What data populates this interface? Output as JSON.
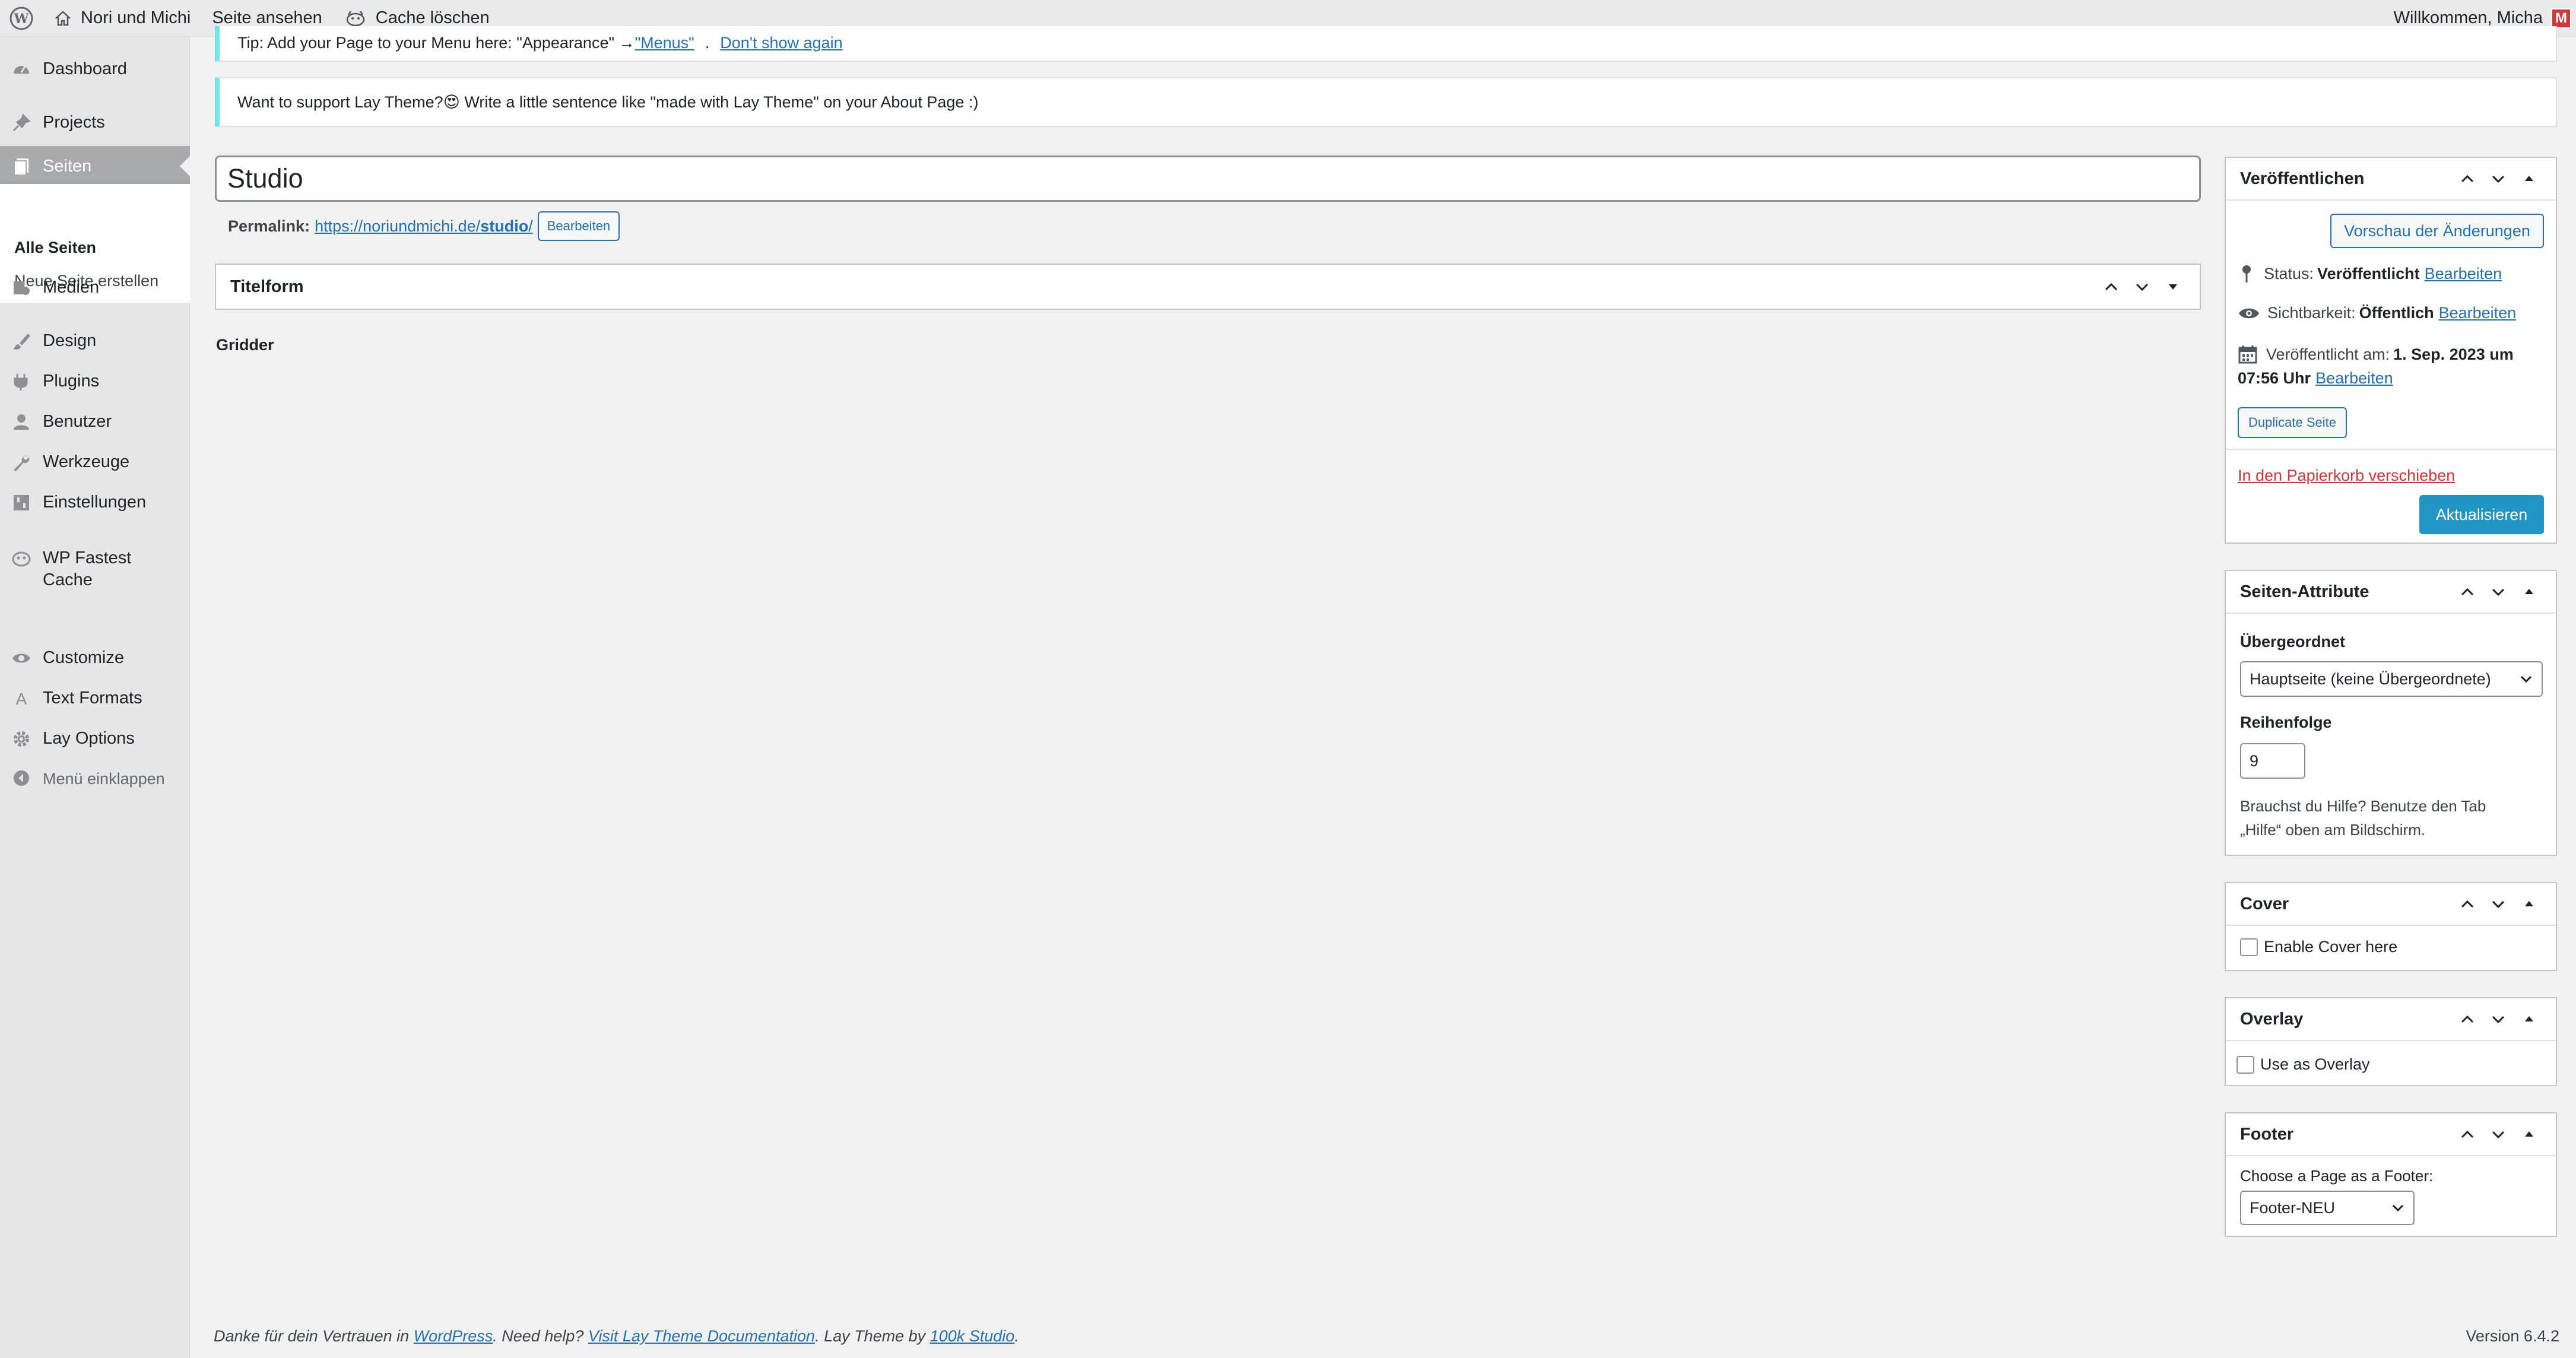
{
  "adminbar": {
    "site_name": "Nori und Michi",
    "view_site": "Seite ansehen",
    "clear_cache": "Cache löschen",
    "welcome": "Willkommen, Micha",
    "avatar_letter": "M"
  },
  "sidebar": {
    "items": [
      {
        "label": "Dashboard",
        "icon": "dashboard-icon"
      },
      {
        "label": "Projects",
        "icon": "pin-icon"
      },
      {
        "label": "Seiten",
        "icon": "pages-icon"
      },
      {
        "label": "Medien",
        "icon": "media-icon"
      },
      {
        "label": "Design",
        "icon": "brush-icon"
      },
      {
        "label": "Plugins",
        "icon": "plugin-icon"
      },
      {
        "label": "Benutzer",
        "icon": "user-icon"
      },
      {
        "label": "Werkzeuge",
        "icon": "wrench-icon"
      },
      {
        "label": "Einstellungen",
        "icon": "settings-icon"
      },
      {
        "label": "WP Fastest Cache",
        "icon": "cheetah-icon"
      },
      {
        "label": "Customize",
        "icon": "eye-icon"
      },
      {
        "label": "Text Formats",
        "icon": "text-icon"
      },
      {
        "label": "Lay Options",
        "icon": "gear-icon"
      }
    ],
    "submenu": [
      "Alle Seiten",
      "Neue Seite erstellen"
    ],
    "collapse": "Menü einklappen"
  },
  "notices": {
    "tip_prefix": "Tip: Add your Page to your Menu here: \"Appearance\" → ",
    "tip_link1": "\"Menus\"",
    "tip_link2": "Don't show again",
    "support": "Want to support Lay Theme?😍 Write a little sentence like \"made with Lay Theme\" on your About Page :)"
  },
  "editor": {
    "title_value": "Studio",
    "permalink_label": "Permalink:",
    "permalink_base": "https://noriundmichi.de/",
    "permalink_slug": "studio",
    "permalink_end": "/",
    "edit_button": "Bearbeiten",
    "titelform_title": "Titelform",
    "gridder_label": "Gridder"
  },
  "publish": {
    "title": "Veröffentlichen",
    "preview_button": "Vorschau der Änderungen",
    "status_label": "Status:",
    "status_value": "Veröffentlicht",
    "visibility_label": "Sichtbarkeit:",
    "visibility_value": "Öffentlich",
    "published_label": "Veröffentlicht am:",
    "published_value_1": "1. Sep. 2023 um",
    "published_value_2": "07:56 Uhr",
    "edit_link": "Bearbeiten",
    "duplicate_button": "Duplicate Seite",
    "trash_link": "In den Papierkorb verschieben",
    "update_button": "Aktualisieren"
  },
  "page_attributes": {
    "title": "Seiten-Attribute",
    "parent_label": "Übergeordnet",
    "parent_value": "Hauptseite (keine Übergeordnete)",
    "order_label": "Reihenfolge",
    "order_value": "9",
    "help_1": "Brauchst du Hilfe? Benutze den Tab",
    "help_2": "„Hilfe“ oben am Bildschirm."
  },
  "cover": {
    "title": "Cover",
    "checkbox_label": "Enable Cover here"
  },
  "overlay": {
    "title": "Overlay",
    "checkbox_label": "Use as Overlay"
  },
  "footer_box": {
    "title": "Footer",
    "label": "Choose a Page as a Footer:",
    "value": "Footer-NEU"
  },
  "footer": {
    "thanks": "Danke für dein Vertrauen in ",
    "wordpress": "WordPress",
    "need_help": ". Need help? ",
    "docs": "Visit Lay Theme Documentation",
    "by": ". Lay Theme by ",
    "studio": "100k Studio",
    "end": ".",
    "version": "Version 6.4.2"
  },
  "colors": {
    "accent": "#2271b1",
    "primary_button": "#2196c4",
    "notice_border": "#72e6e6",
    "danger": "#d63638"
  }
}
